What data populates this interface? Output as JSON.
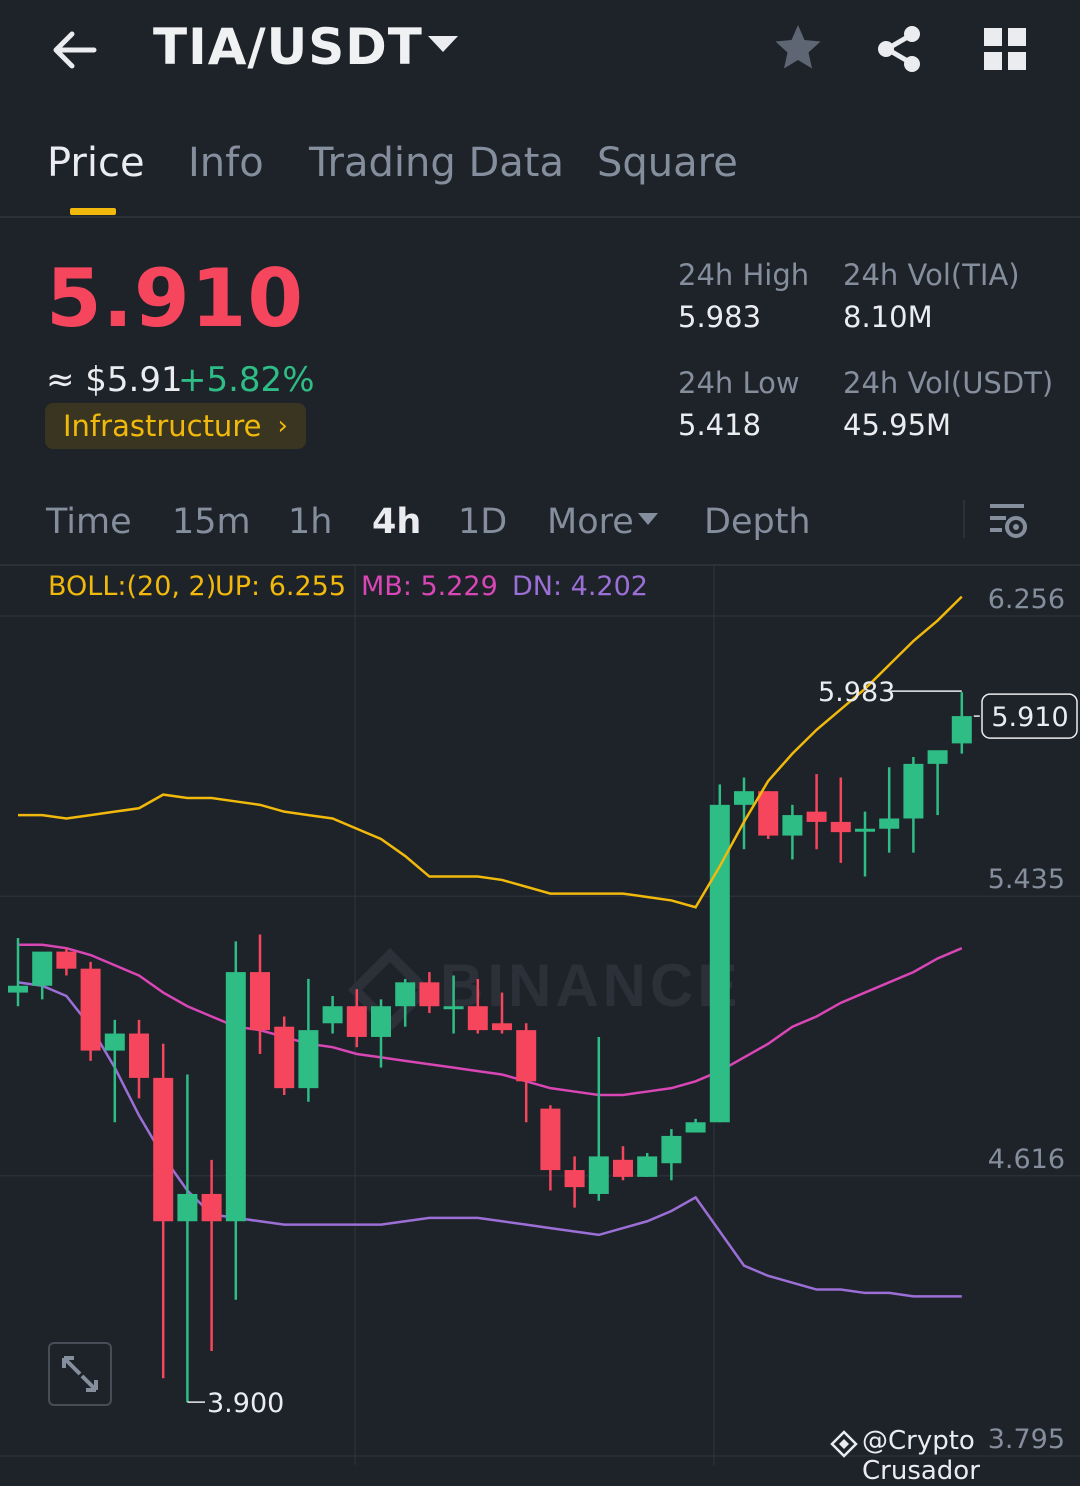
{
  "header": {
    "pair": "TIA/USDT",
    "icons": [
      "arrow-left-icon",
      "caret-down-icon",
      "star-icon",
      "share-icon",
      "grid-icon"
    ]
  },
  "tabs": [
    "Price",
    "Info",
    "Trading Data",
    "Square"
  ],
  "active_tab": "Price",
  "price": {
    "last": "5.910",
    "usd": "≈ $5.91",
    "change": "+5.82%",
    "category": "Infrastructure",
    "high_label": "24h High",
    "high": "5.983",
    "low_label": "24h Low",
    "low": "5.418",
    "vol_tia_label": "24h Vol(TIA)",
    "vol_tia": "8.10M",
    "vol_usdt_label": "24h Vol(USDT)",
    "vol_usdt": "45.95M"
  },
  "intervals": [
    "Time",
    "15m",
    "1h",
    "4h",
    "1D",
    "More",
    "Depth"
  ],
  "active_interval": "4h",
  "colors": {
    "up": "#2ebd85",
    "down": "#f6465d",
    "accent": "#f0b90b",
    "boll_up": "#f0b90b",
    "boll_mb": "#d946b6",
    "boll_dn": "#9b6fd6",
    "background": "#1e2229"
  },
  "chart_data": {
    "type": "candlestick",
    "indicator": {
      "name": "BOLL:(20, 2)",
      "up_label": "UP: 6.255",
      "mb_label": "MB: 5.229",
      "dn_label": "DN: 4.202",
      "up": 6.255,
      "mb": 5.229,
      "dn": 4.202
    },
    "y_axis_labels": [
      "6.256",
      "5.435",
      "4.616",
      "3.795"
    ],
    "ylim": [
      3.795,
      6.256
    ],
    "grid": true,
    "annotations": {
      "high_label": "5.983",
      "high": 5.983,
      "low_label": "3.900",
      "low": 3.9,
      "last_label": "5.910",
      "last": 5.91
    },
    "watermark": "BINANCE",
    "candles": [
      {
        "o": 5.1,
        "h": 5.26,
        "l": 5.06,
        "c": 5.12
      },
      {
        "o": 5.12,
        "h": 5.21,
        "l": 5.08,
        "c": 5.22
      },
      {
        "o": 5.22,
        "h": 5.23,
        "l": 5.15,
        "c": 5.17
      },
      {
        "o": 5.17,
        "h": 5.19,
        "l": 4.9,
        "c": 4.93
      },
      {
        "o": 4.93,
        "h": 5.02,
        "l": 4.72,
        "c": 4.98
      },
      {
        "o": 4.98,
        "h": 5.02,
        "l": 4.79,
        "c": 4.85
      },
      {
        "o": 4.85,
        "h": 4.95,
        "l": 3.97,
        "c": 4.43
      },
      {
        "o": 4.43,
        "h": 4.86,
        "l": 3.9,
        "c": 4.51
      },
      {
        "o": 4.51,
        "h": 4.61,
        "l": 4.05,
        "c": 4.43
      },
      {
        "o": 4.43,
        "h": 5.25,
        "l": 4.2,
        "c": 5.16
      },
      {
        "o": 5.16,
        "h": 5.27,
        "l": 4.92,
        "c": 4.99
      },
      {
        "o": 5.0,
        "h": 5.03,
        "l": 4.8,
        "c": 4.82
      },
      {
        "o": 4.82,
        "h": 5.14,
        "l": 4.78,
        "c": 4.99
      },
      {
        "o": 5.01,
        "h": 5.09,
        "l": 4.98,
        "c": 5.06
      },
      {
        "o": 5.06,
        "h": 5.11,
        "l": 4.94,
        "c": 4.97
      },
      {
        "o": 4.97,
        "h": 5.08,
        "l": 4.88,
        "c": 5.06
      },
      {
        "o": 5.06,
        "h": 5.14,
        "l": 5.0,
        "c": 5.13
      },
      {
        "o": 5.13,
        "h": 5.16,
        "l": 5.04,
        "c": 5.06
      },
      {
        "o": 5.06,
        "h": 5.15,
        "l": 4.98,
        "c": 5.06
      },
      {
        "o": 5.06,
        "h": 5.14,
        "l": 4.98,
        "c": 4.99
      },
      {
        "o": 5.01,
        "h": 5.1,
        "l": 4.98,
        "c": 4.99
      },
      {
        "o": 4.99,
        "h": 5.01,
        "l": 4.72,
        "c": 4.84
      },
      {
        "o": 4.76,
        "h": 4.77,
        "l": 4.52,
        "c": 4.58
      },
      {
        "o": 4.58,
        "h": 4.62,
        "l": 4.47,
        "c": 4.53
      },
      {
        "o": 4.51,
        "h": 4.97,
        "l": 4.49,
        "c": 4.62
      },
      {
        "o": 4.61,
        "h": 4.65,
        "l": 4.55,
        "c": 4.56
      },
      {
        "o": 4.56,
        "h": 4.63,
        "l": 4.56,
        "c": 4.62
      },
      {
        "o": 4.6,
        "h": 4.7,
        "l": 4.55,
        "c": 4.68
      },
      {
        "o": 4.69,
        "h": 4.73,
        "l": 4.69,
        "c": 4.72
      },
      {
        "o": 4.72,
        "h": 5.71,
        "l": 4.72,
        "c": 5.65
      },
      {
        "o": 5.65,
        "h": 5.73,
        "l": 5.52,
        "c": 5.69
      },
      {
        "o": 5.69,
        "h": 5.69,
        "l": 5.55,
        "c": 5.56
      },
      {
        "o": 5.56,
        "h": 5.65,
        "l": 5.49,
        "c": 5.62
      },
      {
        "o": 5.63,
        "h": 5.74,
        "l": 5.52,
        "c": 5.6
      },
      {
        "o": 5.6,
        "h": 5.73,
        "l": 5.48,
        "c": 5.57
      },
      {
        "o": 5.58,
        "h": 5.63,
        "l": 5.44,
        "c": 5.58
      },
      {
        "o": 5.58,
        "h": 5.76,
        "l": 5.51,
        "c": 5.61
      },
      {
        "o": 5.61,
        "h": 5.79,
        "l": 5.51,
        "c": 5.77
      },
      {
        "o": 5.77,
        "h": 5.8,
        "l": 5.62,
        "c": 5.81
      },
      {
        "o": 5.83,
        "h": 5.98,
        "l": 5.8,
        "c": 5.91
      }
    ],
    "boll_upper": [
      5.62,
      5.62,
      5.61,
      5.62,
      5.63,
      5.64,
      5.68,
      5.67,
      5.67,
      5.66,
      5.65,
      5.63,
      5.62,
      5.61,
      5.58,
      5.55,
      5.5,
      5.44,
      5.44,
      5.44,
      5.43,
      5.41,
      5.39,
      5.39,
      5.39,
      5.39,
      5.38,
      5.37,
      5.35,
      5.47,
      5.6,
      5.72,
      5.8,
      5.87,
      5.93,
      5.99,
      6.06,
      6.13,
      6.19,
      6.26
    ],
    "boll_mid": [
      5.24,
      5.24,
      5.23,
      5.21,
      5.18,
      5.15,
      5.1,
      5.06,
      5.03,
      5.0,
      4.99,
      4.97,
      4.95,
      4.94,
      4.92,
      4.91,
      4.9,
      4.89,
      4.88,
      4.87,
      4.86,
      4.84,
      4.82,
      4.81,
      4.8,
      4.8,
      4.81,
      4.82,
      4.84,
      4.87,
      4.91,
      4.95,
      5.0,
      5.03,
      5.07,
      5.1,
      5.13,
      5.16,
      5.2,
      5.23
    ],
    "boll_lower": [
      5.13,
      5.12,
      5.09,
      5.0,
      4.88,
      4.74,
      4.62,
      4.52,
      4.45,
      4.44,
      4.43,
      4.42,
      4.42,
      4.42,
      4.42,
      4.42,
      4.43,
      4.44,
      4.44,
      4.44,
      4.43,
      4.42,
      4.41,
      4.4,
      4.39,
      4.41,
      4.43,
      4.46,
      4.5,
      4.4,
      4.3,
      4.27,
      4.25,
      4.23,
      4.23,
      4.22,
      4.22,
      4.21,
      4.21,
      4.21
    ]
  },
  "credit": "@Crypto Crusador"
}
